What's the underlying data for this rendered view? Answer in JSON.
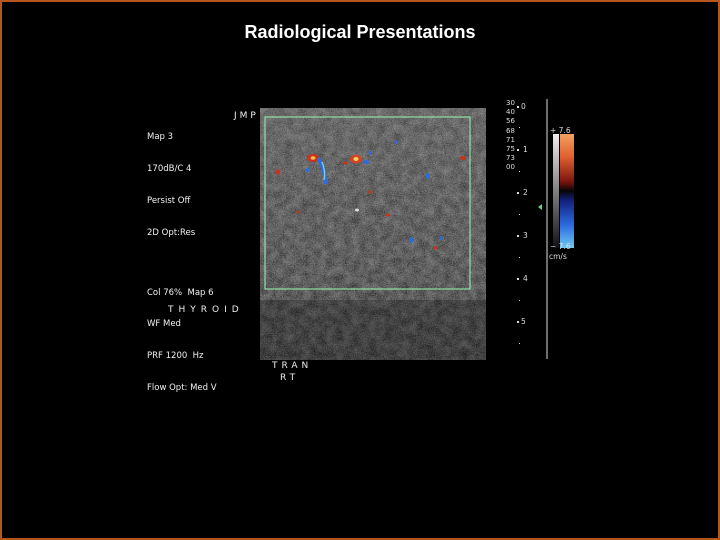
{
  "slide": {
    "title": "Radiological Presentations"
  },
  "ultrasound": {
    "settings": [
      "Map 3",
      "170dB/C 4",
      "Persist Off",
      "2D Opt:Res"
    ],
    "color_settings": [
      "Col 76%  Map 6",
      "WF Med",
      "PRF 1200  Hz",
      "Flow Opt: Med V"
    ],
    "operator": "JMP",
    "organ_label": "THYROID",
    "orientation": [
      "TRAN",
      "RT"
    ],
    "depth_markers": [
      "0",
      "1",
      "2",
      "3",
      "4",
      "5"
    ],
    "gain_rows": [
      "30",
      "40",
      "56",
      "68",
      "71",
      "75",
      "73",
      "00"
    ],
    "velocity_scale": {
      "top": "+ 7.6",
      "bottom": "− 7.6",
      "unit": "cm/s"
    },
    "colors": {
      "frame": "#b5561e",
      "roi_box": "#8fe0a6",
      "doppler_red": "#c8331e",
      "doppler_blue": "#2d6be0"
    }
  }
}
